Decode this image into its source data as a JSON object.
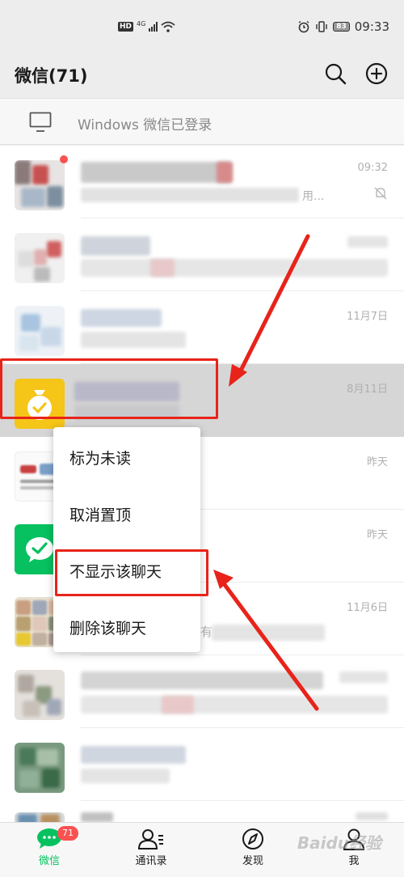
{
  "status_bar": {
    "hd": "HD",
    "network": "4G",
    "battery": "83",
    "time": "09:33"
  },
  "header": {
    "title": "微信(71)",
    "icons": [
      "search-icon",
      "add-icon"
    ]
  },
  "login_banner": {
    "text": "Windows 微信已登录",
    "icon": "monitor-icon"
  },
  "chats": [
    {
      "time": "09:32",
      "preview_suffix": "用...",
      "muted": true,
      "unread_dot": true
    },
    {
      "time": ""
    },
    {
      "time": "11月7日"
    },
    {
      "time": "8月11日",
      "highlighted": true
    },
    {
      "time": "昨天"
    },
    {
      "time": "昨天"
    },
    {
      "time": "11月6日",
      "preview_suffix": "有"
    },
    {
      "time": ""
    },
    {
      "time": ""
    },
    {
      "time": ""
    }
  ],
  "context_menu": {
    "items": [
      "标为未读",
      "取消置顶",
      "不显示该聊天",
      "删除该聊天"
    ]
  },
  "tab_bar": {
    "tabs": [
      {
        "label": "微信",
        "icon": "chat-icon",
        "active": true,
        "badge": "71"
      },
      {
        "label": "通讯录",
        "icon": "contacts-icon"
      },
      {
        "label": "发现",
        "icon": "compass-icon"
      },
      {
        "label": "我",
        "icon": "person-icon"
      }
    ]
  },
  "colors": {
    "accent": "#07c160",
    "badge": "#fa5151",
    "annotation": "#e8231a",
    "background": "#ededed"
  },
  "watermark": "Baidu经验"
}
